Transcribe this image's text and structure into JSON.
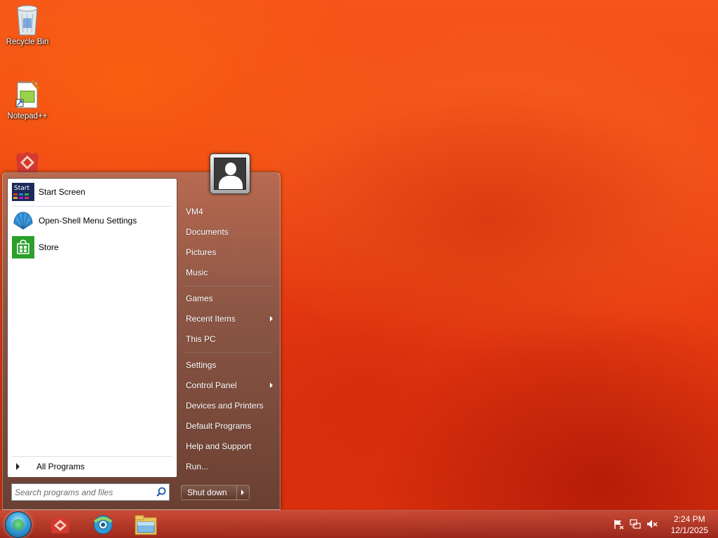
{
  "desktop": {
    "icons": [
      {
        "label": "Recycle Bin",
        "icon": "recycle-bin-icon"
      },
      {
        "label": "Notepad++",
        "icon": "notepad-plus-plus-icon"
      },
      {
        "label": "",
        "icon": "app-icon"
      }
    ]
  },
  "start_menu": {
    "pinned": [
      {
        "label": "Start Screen",
        "icon": "start-screen-icon",
        "icon_text": "Start"
      },
      {
        "label": "Open-Shell Menu Settings",
        "icon": "shell-icon"
      },
      {
        "label": "Store",
        "icon": "store-icon"
      }
    ],
    "all_programs_label": "All Programs",
    "search": {
      "placeholder": "Search programs and files",
      "value": ""
    },
    "right_items": [
      {
        "label": "VM4",
        "submenu": false
      },
      {
        "label": "Documents",
        "submenu": false
      },
      {
        "label": "Pictures",
        "submenu": false
      },
      {
        "label": "Music",
        "submenu": false
      },
      {
        "label": "Games",
        "submenu": false
      },
      {
        "label": "Recent Items",
        "submenu": true
      },
      {
        "label": "This PC",
        "submenu": false
      },
      {
        "label": "Settings",
        "submenu": false
      },
      {
        "label": "Control Panel",
        "submenu": true
      },
      {
        "label": "Devices and Printers",
        "submenu": false
      },
      {
        "label": "Default Programs",
        "submenu": false
      },
      {
        "label": "Help and Support",
        "submenu": false
      },
      {
        "label": "Run...",
        "submenu": false
      }
    ],
    "shutdown_label": "Shut down"
  },
  "taskbar": {
    "buttons": [
      "app-icon",
      "browser-icon",
      "file-explorer-icon"
    ],
    "tray": [
      "flag-icon",
      "network-icon",
      "volume-muted-icon"
    ],
    "clock": {
      "time": "2:24 PM",
      "date": "12/1/2025"
    }
  }
}
